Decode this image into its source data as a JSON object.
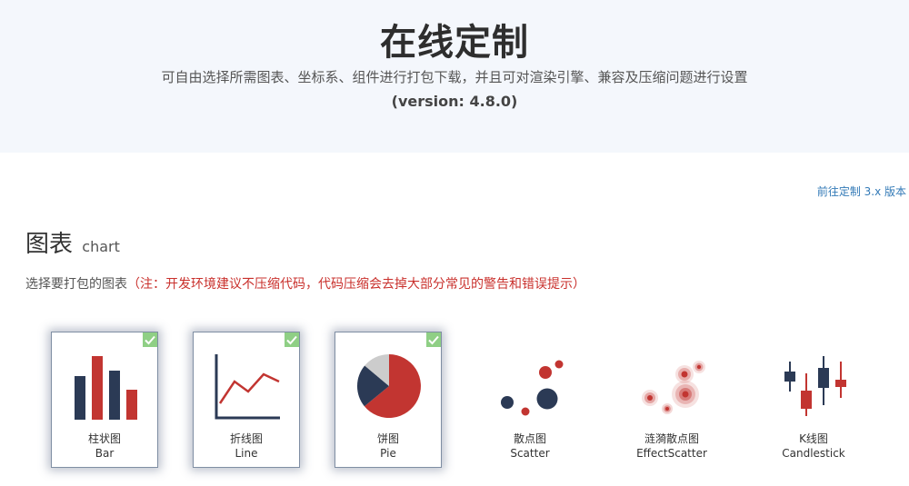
{
  "header": {
    "title": "在线定制",
    "subtitle": "可自由选择所需图表、坐标系、组件进行打包下载，并且可对渲染引擎、兼容及压缩问题进行设置",
    "version": "(version: 4.8.0)"
  },
  "legacy_link": "前往定制 3.x 版本",
  "section": {
    "title": "图表",
    "title_en": "chart",
    "hint": "选择要打包的图表",
    "hint_warning": "（注：开发环境建议不压缩代码，代码压缩会去掉大部分常见的警告和错误提示）"
  },
  "colors": {
    "dark": "#2b3a55",
    "red": "#c23531",
    "gray": "#cccccc",
    "check": "#8fcf85"
  },
  "charts": [
    {
      "name": "柱状图",
      "en": "Bar",
      "icon": "bar-chart-icon",
      "checked": true
    },
    {
      "name": "折线图",
      "en": "Line",
      "icon": "line-chart-icon",
      "checked": true
    },
    {
      "name": "饼图",
      "en": "Pie",
      "icon": "pie-chart-icon",
      "checked": true
    },
    {
      "name": "散点图",
      "en": "Scatter",
      "icon": "scatter-chart-icon",
      "checked": false
    },
    {
      "name": "涟漪散点图",
      "en": "EffectScatter",
      "icon": "effect-scatter-chart-icon",
      "checked": false
    },
    {
      "name": "K线图",
      "en": "Candlestick",
      "icon": "candlestick-chart-icon",
      "checked": false
    }
  ]
}
